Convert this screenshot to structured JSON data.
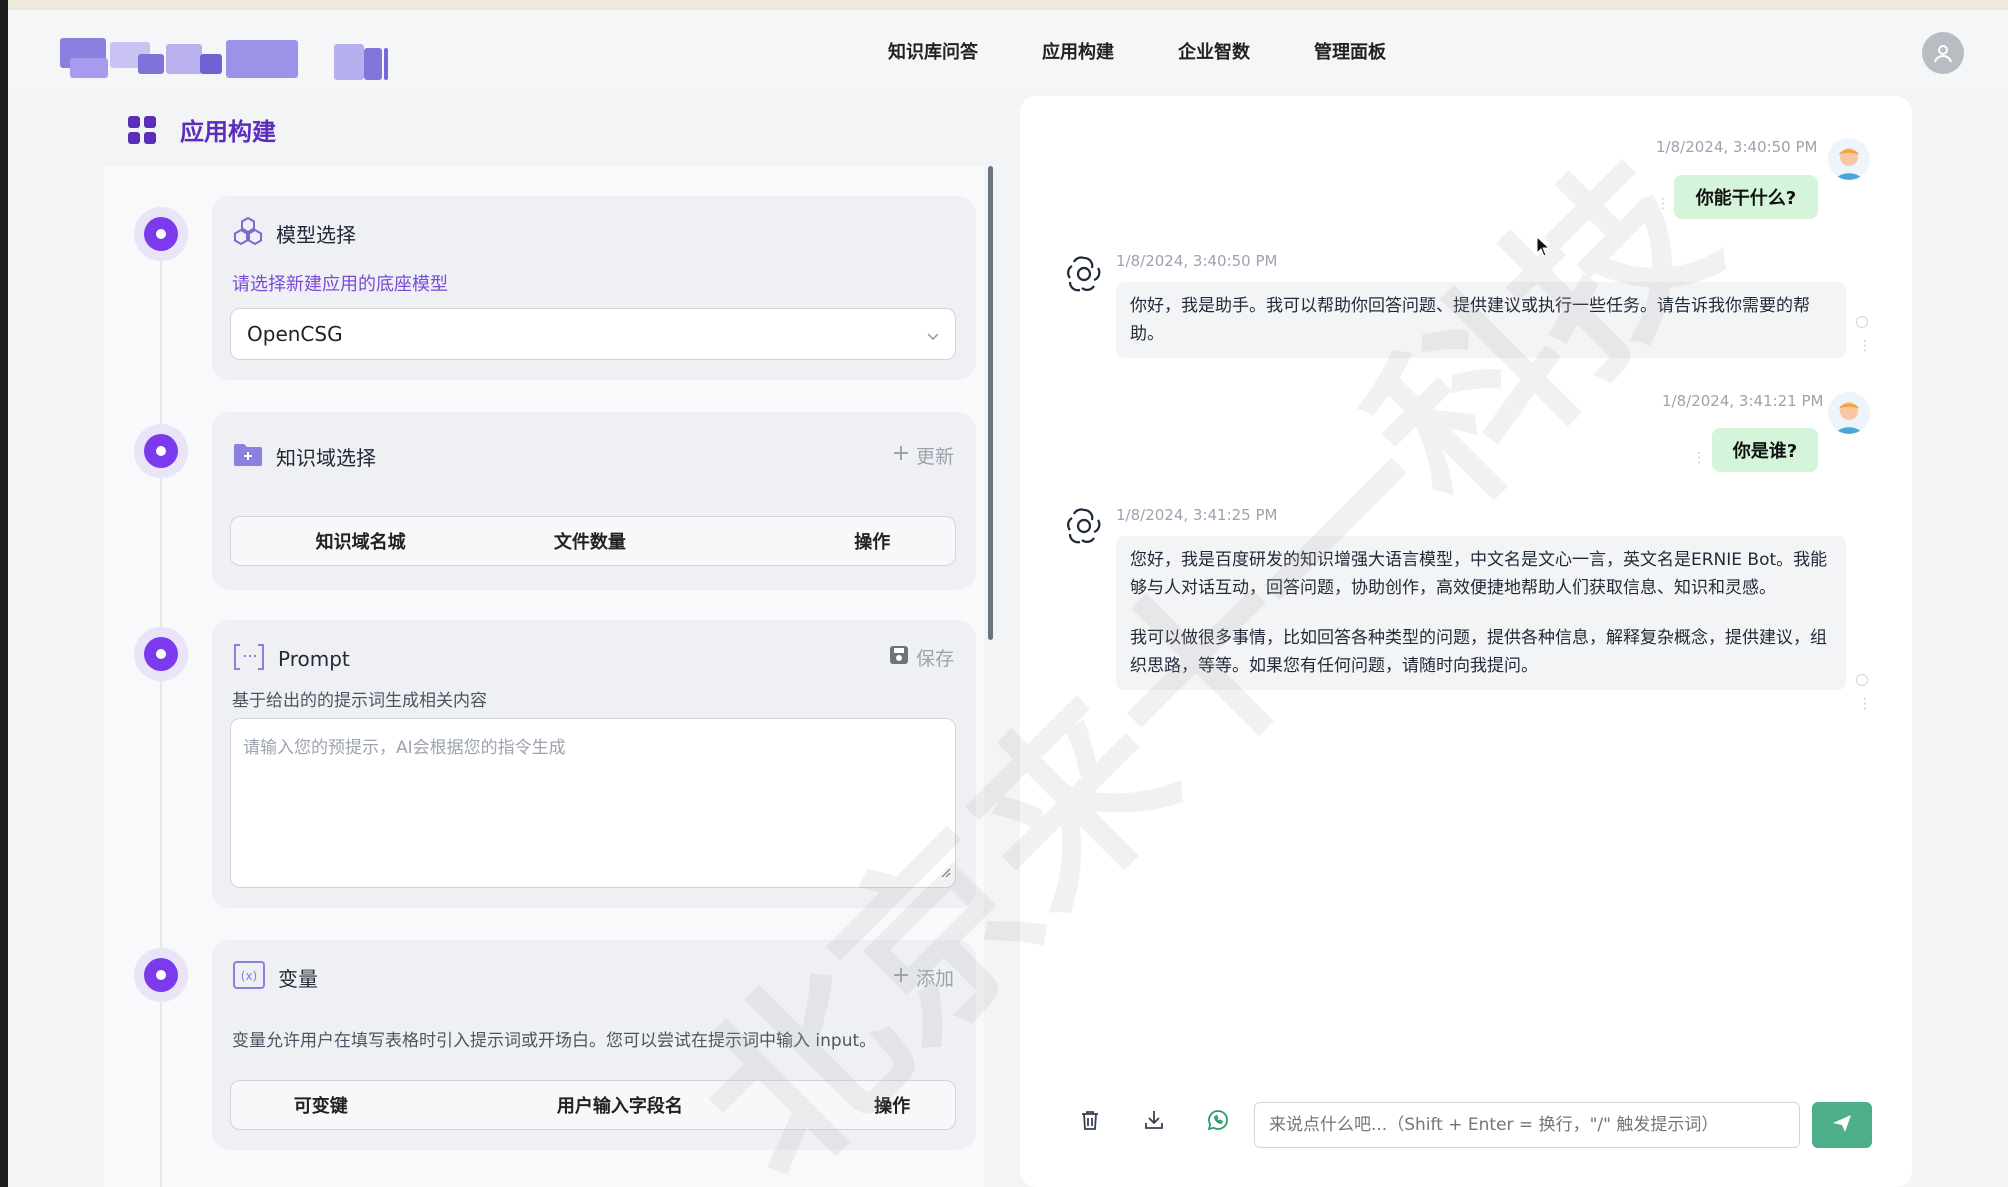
{
  "nav": {
    "items": [
      "知识库问答",
      "应用构建",
      "企业智数",
      "管理面板"
    ]
  },
  "page": {
    "title": "应用构建"
  },
  "model_select": {
    "label": "模型选择",
    "hint": "请选择新建应用的底座模型",
    "value": "OpenCSG"
  },
  "knowledge": {
    "label": "知识域选择",
    "action": "更新",
    "columns": [
      "知识域名城",
      "文件数量",
      "操作"
    ]
  },
  "prompt": {
    "label": "Prompt",
    "action": "保存",
    "description": "基于给出的的提示词生成相关内容",
    "placeholder": "请输入您的预提示，AI会根据您的指令生成"
  },
  "variables": {
    "label": "变量",
    "action": "添加",
    "description": "变量允许用户在填写表格时引入提示词或开场白。您可以尝试在提示词中输入 input。",
    "columns": [
      "可变键",
      "用户输入字段名",
      "操作"
    ]
  },
  "chat": {
    "messages": [
      {
        "role": "user",
        "time": "1/8/2024, 3:40:50 PM",
        "text": "你能干什么?"
      },
      {
        "role": "bot",
        "time": "1/8/2024, 3:40:50 PM",
        "paragraphs": [
          "你好，我是助手。我可以帮助你回答问题、提供建议或执行一些任务。请告诉我你需要的帮助。"
        ]
      },
      {
        "role": "user",
        "time": "1/8/2024, 3:41:21 PM",
        "text": "你是谁?"
      },
      {
        "role": "bot",
        "time": "1/8/2024, 3:41:25 PM",
        "paragraphs": [
          "您好，我是百度研发的知识增强大语言模型，中文名是文心一言，英文名是ERNIE Bot。我能够与人对话互动，回答问题，协助创作，高效便捷地帮助人们获取信息、知识和灵感。",
          "我可以做很多事情，比如回答各种类型的问题，提供各种信息，解释复杂概念，提供建议，组织思路，等等。如果您有任何问题，请随时向我提问。"
        ]
      }
    ],
    "input_placeholder": "来说点什么吧...（Shift + Enter = 换行，\"/\" 触发提示词）",
    "tools": [
      "trash-icon",
      "download-icon",
      "whatsapp-icon"
    ]
  },
  "watermark": "北京来十一科技",
  "colors": {
    "accent": "#5b2dbb",
    "dot": "#7c3aed",
    "user_bubble": "#d4f5d9",
    "send": "#4caf8a"
  }
}
